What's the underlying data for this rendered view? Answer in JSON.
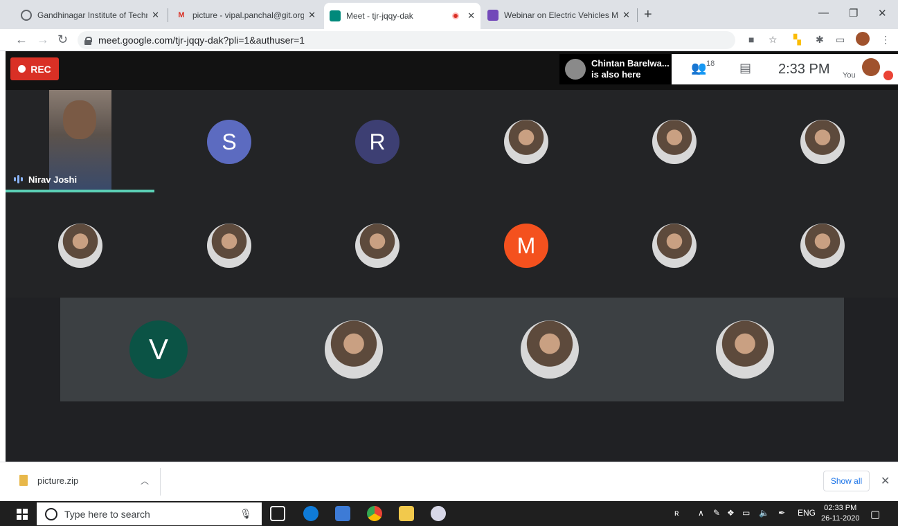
{
  "browser": {
    "tabs": [
      {
        "title": "Gandhinagar Institute of Technol",
        "icon": "globe-icon"
      },
      {
        "title": "picture - vipal.panchal@git.org.ir",
        "icon": "gmail-icon"
      },
      {
        "title": "Meet - tjr-jqqy-dak",
        "icon": "meet-icon"
      },
      {
        "title": "Webinar on Electric Vehicles Mod",
        "icon": "forms-icon"
      }
    ],
    "url": "meet.google.com/tjr-jqqy-dak?pli=1&authuser=1"
  },
  "meet": {
    "rec_label": "REC",
    "notice": {
      "name": "Chintan Barelwa...",
      "text": "is also here"
    },
    "participant_count": "18",
    "time": "2:33 PM",
    "you_label": "You",
    "speaker_name": "Nirav Joshi",
    "tiles": [
      {
        "kind": "letter",
        "letter": "S",
        "color": "#5c6bc0"
      },
      {
        "kind": "letter",
        "letter": "R",
        "color": "#3d3f73"
      },
      {
        "kind": "photo"
      },
      {
        "kind": "photo"
      },
      {
        "kind": "photo"
      },
      {
        "kind": "photo"
      },
      {
        "kind": "photo"
      },
      {
        "kind": "photo"
      },
      {
        "kind": "letter",
        "letter": "M",
        "color": "#f4511e"
      },
      {
        "kind": "photo"
      },
      {
        "kind": "photo"
      },
      {
        "kind": "letter",
        "letter": "V",
        "color": "#0b5345"
      },
      {
        "kind": "photo"
      },
      {
        "kind": "photo"
      },
      {
        "kind": "photo"
      }
    ]
  },
  "downloads": {
    "file": "picture.zip",
    "show_all": "Show all"
  },
  "taskbar": {
    "search_placeholder": "Type here to search",
    "lang": "ENG",
    "time": "02:33 PM",
    "date": "26-11-2020"
  }
}
